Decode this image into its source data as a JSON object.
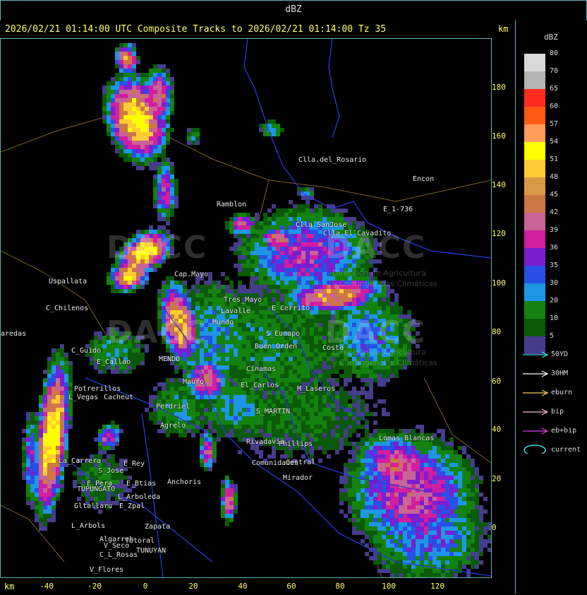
{
  "header": {
    "title": "dBZ"
  },
  "info": {
    "line": "2026/02/21 01:14:00 UTC Composite Tracks to 2026/02/21 01:14:00 Tz 35",
    "km_top": "km"
  },
  "axes": {
    "y_ticks": [
      "180",
      "160",
      "140",
      "120",
      "100",
      "80",
      "60",
      "40",
      "20",
      "0"
    ],
    "x_ticks": [
      "-40",
      "-20",
      "0",
      "20",
      "40",
      "60",
      "80",
      "100",
      "120"
    ],
    "km_bottom": "km"
  },
  "legend": {
    "title": "dBZ",
    "levels": [
      {
        "label": "80",
        "color": "#d9d9d9"
      },
      {
        "label": "70",
        "color": "#b4b4b4"
      },
      {
        "label": "65",
        "color": "#ff2a1e"
      },
      {
        "label": "60",
        "color": "#ff5a14"
      },
      {
        "label": "57",
        "color": "#ff9c5a"
      },
      {
        "label": "54",
        "color": "#ffff00"
      },
      {
        "label": "51",
        "color": "#ffcc33"
      },
      {
        "label": "48",
        "color": "#d99944"
      },
      {
        "label": "45",
        "color": "#cc7744"
      },
      {
        "label": "42",
        "color": "#c86496"
      },
      {
        "label": "39",
        "color": "#d21ea0"
      },
      {
        "label": "36",
        "color": "#7a1ed2"
      },
      {
        "label": "35",
        "color": "#2850e6"
      },
      {
        "label": "30",
        "color": "#1e96e6"
      },
      {
        "label": "20",
        "color": "#14820f"
      },
      {
        "label": "10",
        "color": "#0a5a0a"
      },
      {
        "label": "5",
        "color": "#463c8c"
      }
    ],
    "tracks": [
      {
        "label": "50YD",
        "color": "#33dddd"
      },
      {
        "label": "30HM",
        "color": "#ffffff"
      },
      {
        "label": "eburn",
        "color": "#ffcc66"
      },
      {
        "label": "bip",
        "color": "#ffbbcc"
      },
      {
        "label": "eb+bip",
        "color": "#dd44dd"
      }
    ],
    "current_label": "current",
    "current_color": "#33dddd"
  },
  "places": [
    {
      "name": "Clla.del_Rosario"
    },
    {
      "name": "Ramblon"
    },
    {
      "name": "Encon"
    },
    {
      "name": "E_1-736"
    },
    {
      "name": "Clla.SanJose"
    },
    {
      "name": "Clla.El_Cavadito"
    },
    {
      "name": "Uspallata"
    },
    {
      "name": "C_Chilenos"
    },
    {
      "name": "aredas"
    },
    {
      "name": "C_Guido"
    },
    {
      "name": "E_Callao"
    },
    {
      "name": "MENDO"
    },
    {
      "name": "Potrerillos"
    },
    {
      "name": "L_Vegas"
    },
    {
      "name": "Cacheut"
    },
    {
      "name": "Perdriel"
    },
    {
      "name": "Agrelo"
    },
    {
      "name": "M_Laseros"
    },
    {
      "name": "S_MARTIN"
    },
    {
      "name": "La_Carrera"
    },
    {
      "name": "S_Jose"
    },
    {
      "name": "E_Rey"
    },
    {
      "name": "E_Pera"
    },
    {
      "name": "TUPUNGATO"
    },
    {
      "name": "E_Btias"
    },
    {
      "name": "Anchoris"
    },
    {
      "name": "Gltallaru"
    },
    {
      "name": "E_Zpal"
    },
    {
      "name": "L_Arboleda"
    },
    {
      "name": "L_Arbols"
    },
    {
      "name": "Zapata"
    },
    {
      "name": "Algarrob"
    },
    {
      "name": "V_Seco"
    },
    {
      "name": "Totoral"
    },
    {
      "name": "TUNUYAN"
    },
    {
      "name": "C_L_Rosas"
    },
    {
      "name": "V_Flores"
    },
    {
      "name": "Lomas_Blancas"
    },
    {
      "name": "Mirador"
    },
    {
      "name": "Central"
    },
    {
      "name": "Phillips"
    },
    {
      "name": "Tres_Mayo"
    },
    {
      "name": "E_Cerrito"
    },
    {
      "name": "Lavalle"
    },
    {
      "name": "Mundo"
    },
    {
      "name": "S_Eunapo"
    },
    {
      "name": "Costa"
    },
    {
      "name": "Buen_Orden"
    },
    {
      "name": "Cinamas"
    },
    {
      "name": "El_Carlos"
    },
    {
      "name": "Rivadavia"
    },
    {
      "name": "Comunidades"
    },
    {
      "name": "Mauro"
    },
    {
      "name": "Cap.Mayo"
    }
  ],
  "watermark": {
    "text1": "DACC",
    "text2": "DACC",
    "sub1": "Dirección de Agricultura",
    "sub2": "y Contingencias Climáticas",
    "sub3": "Dirección de Agricultura",
    "sub4": "y Contingencias Climáticas"
  }
}
